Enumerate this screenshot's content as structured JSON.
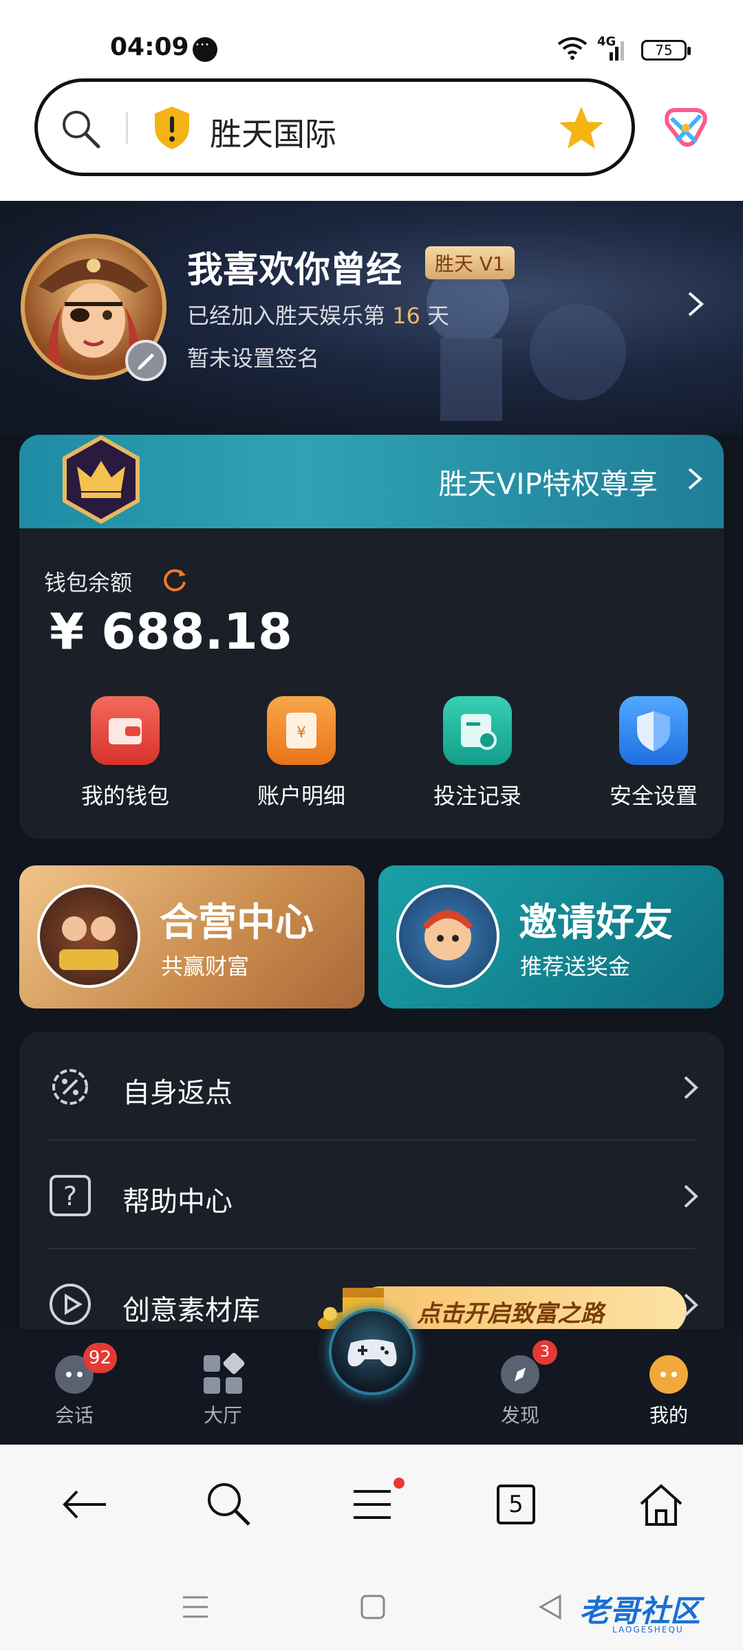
{
  "status_bar": {
    "time": "04:09",
    "network": "4G",
    "battery": "75"
  },
  "url_bar": {
    "title": "胜天国际"
  },
  "profile": {
    "name": "我喜欢你曾经",
    "vip_tag": "胜天 V1",
    "joined_prefix": "已经加入胜天娱乐第",
    "joined_days": "16",
    "joined_suffix": "天",
    "signature": "暂未设置签名"
  },
  "vip_banner": {
    "label": "胜天VIP特权尊享"
  },
  "wallet": {
    "label": "钱包余额",
    "balance": "¥ 688.18"
  },
  "quick_actions": [
    {
      "label": "我的钱包",
      "color": "#e9473f"
    },
    {
      "label": "账户明细",
      "color": "#f38b2a"
    },
    {
      "label": "投注记录",
      "color": "#1fb5a0"
    },
    {
      "label": "安全设置",
      "color": "#2f8ef0"
    }
  ],
  "promos": [
    {
      "title": "合营中心",
      "subtitle": "共赢财富"
    },
    {
      "title": "邀请好友",
      "subtitle": "推荐送奖金"
    }
  ],
  "menu_items": [
    {
      "label": "自身返点",
      "icon": "percent-gear-icon"
    },
    {
      "label": "帮助中心",
      "icon": "question-icon"
    },
    {
      "label": "创意素材库",
      "icon": "play-icon",
      "banner": "点击开启致富之路"
    }
  ],
  "tabbar": [
    {
      "label": "会话",
      "badge": "92"
    },
    {
      "label": "大厅"
    },
    {
      "label": "发现",
      "badge": "3"
    },
    {
      "label": "我的"
    }
  ],
  "browser_bar": {
    "tab_count": "5"
  },
  "watermark": {
    "text": "老哥社区",
    "sub": "LAOGESHEQU"
  }
}
